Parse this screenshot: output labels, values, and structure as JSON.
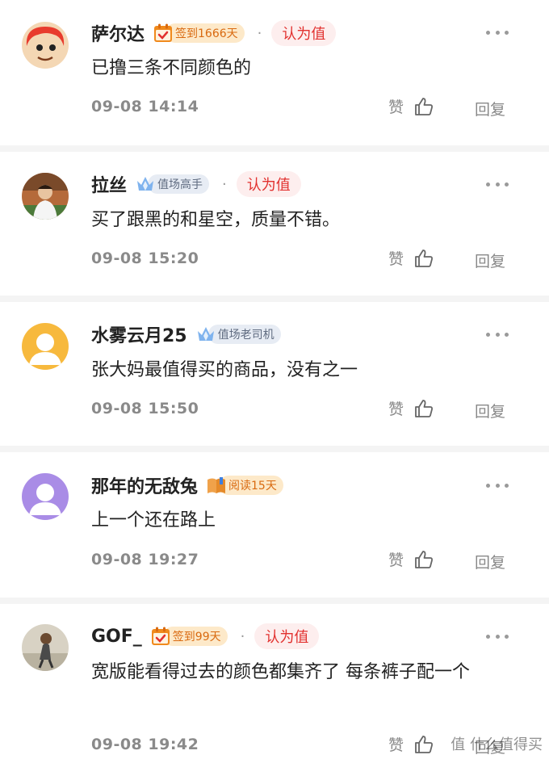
{
  "comments": [
    {
      "username": "萨尔达",
      "badge": {
        "label": "签到1666天",
        "style": "orange",
        "icon": "calendar-check-icon"
      },
      "tag": "认为值",
      "dot": "·",
      "content": "已撸三条不同颜色的",
      "time": "09-08 14:14",
      "like_label": "赞",
      "reply_label": "回复"
    },
    {
      "username": "拉丝",
      "badge": {
        "label": "值场高手",
        "style": "blue",
        "icon": "crown-icon"
      },
      "tag": "认为值",
      "dot": "·",
      "content": "买了跟黑的和星空，质量不错。",
      "time": "09-08 15:20",
      "like_label": "赞",
      "reply_label": "回复"
    },
    {
      "username": "水雾云月25",
      "badge": {
        "label": "值场老司机",
        "style": "blue",
        "icon": "crown-icon"
      },
      "tag": "",
      "dot": "",
      "content": "张大妈最值得买的商品，没有之一",
      "time": "09-08 15:50",
      "like_label": "赞",
      "reply_label": "回复"
    },
    {
      "username": "那年的无敌兔",
      "badge": {
        "label": "阅读15天",
        "style": "orange",
        "icon": "book-icon"
      },
      "tag": "",
      "dot": "",
      "content": "上一个还在路上",
      "time": "09-08 19:27",
      "like_label": "赞",
      "reply_label": "回复"
    },
    {
      "username": "GOF_",
      "badge": {
        "label": "签到99天",
        "style": "orange",
        "icon": "calendar-check-icon"
      },
      "tag": "认为值",
      "dot": "·",
      "content": "宽版能看得过去的颜色都集齐了  每条裤子配一个",
      "time": "09-08 19:42",
      "like_label": "赞",
      "reply_label": "回复"
    }
  ],
  "watermark": "值 什么值得买",
  "colors": {
    "accent_red": "#e2312f",
    "badge_orange": "#d96a10",
    "badge_blue": "#5f6b80"
  }
}
